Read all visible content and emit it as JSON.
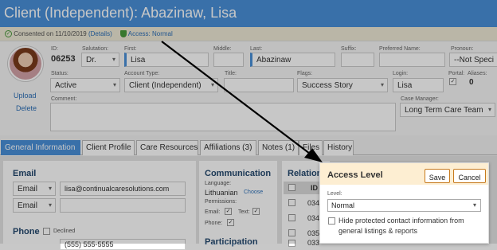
{
  "title": "Client (Independent): Abazinaw, Lisa",
  "consent": {
    "text": "Consented on 11/10/2019",
    "details_link": "(Details)",
    "access_link": "Access: Normal"
  },
  "avatar_links": {
    "upload": "Upload",
    "delete": "Delete"
  },
  "fields": {
    "id_label": "ID:",
    "id_value": "06253",
    "salutation_label": "Salutation:",
    "salutation_value": "Dr.",
    "first_label": "First:",
    "first_value": "Lisa",
    "middle_label": "Middle:",
    "middle_value": "",
    "last_label": "Last:",
    "last_value": "Abazinaw",
    "suffix_label": "Suffix:",
    "suffix_value": "",
    "preferred_label": "Preferred Name:",
    "preferred_value": "",
    "pronoun_label": "Pronoun:",
    "pronoun_value": "--Not Speci",
    "status_label": "Status:",
    "status_value": "Active",
    "account_label": "Account Type:",
    "account_value": "Client (Independent)",
    "title_label": "Title:",
    "title_value": "",
    "flags_label": "Flags:",
    "flags_value": "Success Story",
    "login_label": "Login:",
    "login_value": "Lisa",
    "portal_label": "Portal:",
    "portal_checked": "✓",
    "aliases_label": "Aliases:",
    "aliases_value": "0",
    "comment_label": "Comment:",
    "comment_value": "",
    "case_manager_label": "Case Manager:",
    "case_manager_value": "Long Term Care Team"
  },
  "tabs": [
    {
      "label": "General Information",
      "active": true
    },
    {
      "label": "Client Profile"
    },
    {
      "label": "Care Resources"
    },
    {
      "label": "Affiliations (3)"
    },
    {
      "label": "Notes (1)"
    },
    {
      "label": "Files"
    },
    {
      "label": "History"
    }
  ],
  "email": {
    "heading": "Email",
    "rows": [
      {
        "type": "Email",
        "value": "lisa@continualcaresolutions.com"
      },
      {
        "type": "Email",
        "value": ""
      }
    ]
  },
  "phone": {
    "heading": "Phone",
    "declined_label": "Declined",
    "row_value": "(555) 555-5555"
  },
  "communication": {
    "heading": "Communication",
    "language_label": "Language:",
    "language_value": "Lithuanian",
    "choose_link": "Choose",
    "permissions_label": "Permissions:",
    "email_label": "Email:",
    "text_label": "Text:",
    "phone_label": "Phone:",
    "checked_mark": "✓"
  },
  "participation": {
    "heading": "Participation"
  },
  "relations": {
    "heading": "Relations",
    "id_col": "ID",
    "rows": [
      "034",
      "034",
      "035",
      "033"
    ]
  },
  "popup": {
    "title": "Access Level",
    "save_label": "Save",
    "cancel_label": "Cancel",
    "level_label": "Level:",
    "level_value": "Normal",
    "hide_text": "Hide protected contact information from general listings & reports"
  },
  "colors": {
    "header": "#4a90d9",
    "popup_header": "#fdeed2",
    "button_border": "#c77a1d",
    "link": "#2c6fb7"
  }
}
